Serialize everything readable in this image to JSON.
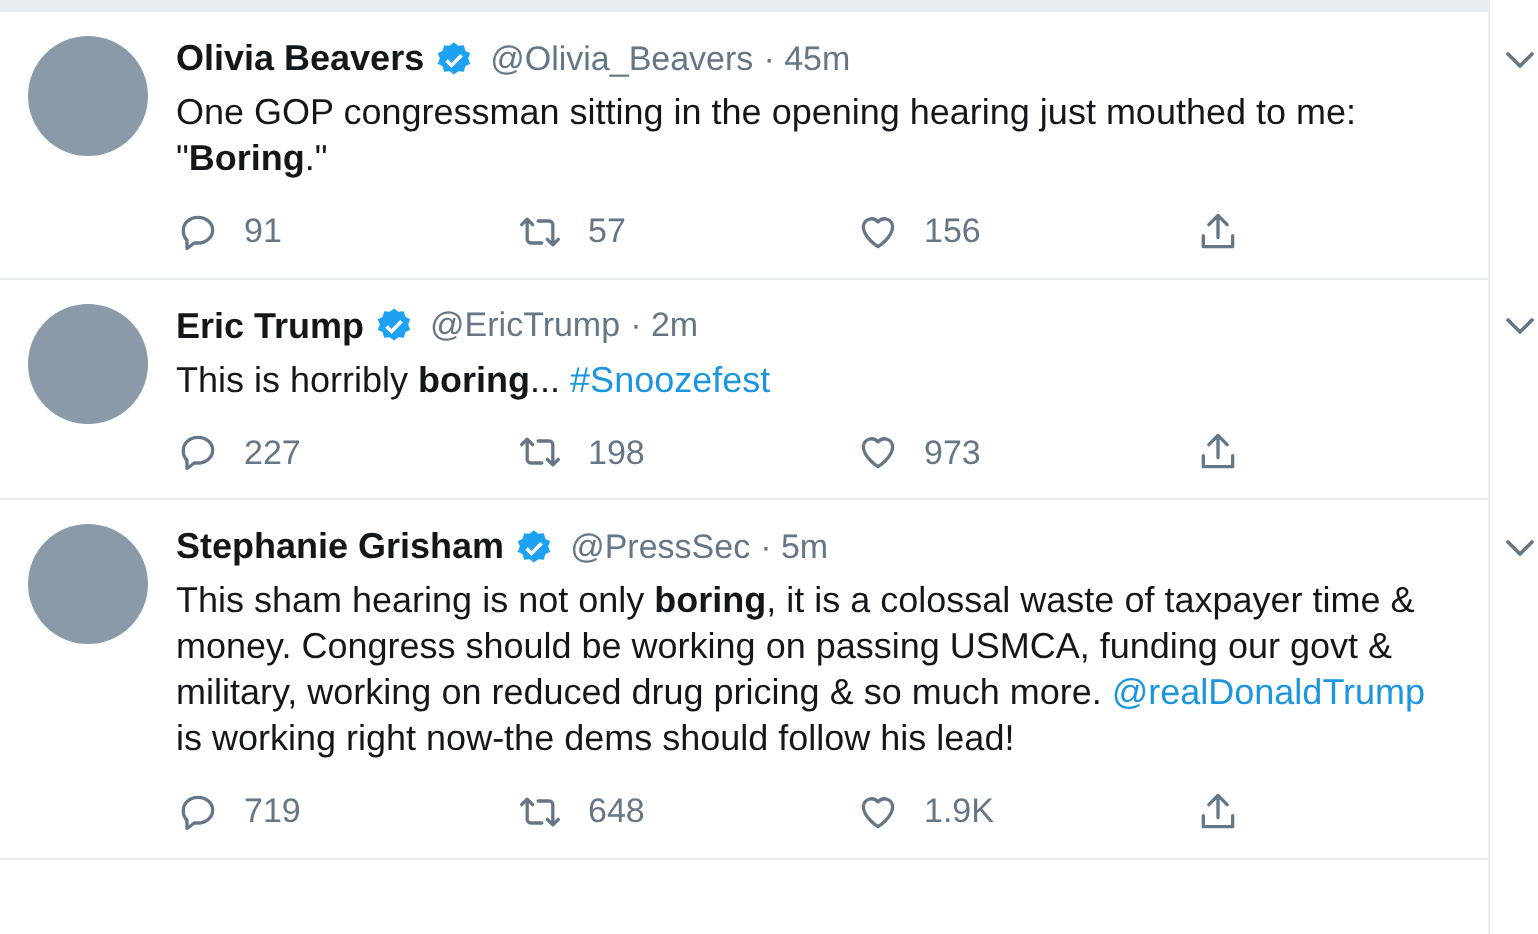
{
  "tweets": [
    {
      "name": "Olivia Beavers",
      "verified": true,
      "handle": "@Olivia_Beavers",
      "time": "· 45m",
      "segments": [
        {
          "kind": "text",
          "text": "One GOP congressman sitting in the opening hearing just mouthed to me: \"**Boring**.\""
        }
      ],
      "replies": "91",
      "retweets": "57",
      "likes": "156"
    },
    {
      "name": "Eric Trump",
      "verified": true,
      "handle": "@EricTrump",
      "time": "· 2m",
      "segments": [
        {
          "kind": "text",
          "text": "This is horribly **boring**... "
        },
        {
          "kind": "link",
          "text": "#Snoozefest"
        }
      ],
      "replies": "227",
      "retweets": "198",
      "likes": "973"
    },
    {
      "name": "Stephanie Grisham",
      "verified": true,
      "handle": "@PressSec",
      "time": "· 5m",
      "segments": [
        {
          "kind": "text",
          "text": "This sham hearing is not only **boring**, it is a colossal waste of taxpayer time & money. Congress should be working on passing USMCA, funding our govt & military, working on reduced drug pricing & so much more. "
        },
        {
          "kind": "link",
          "text": "@realDonaldTrump"
        },
        {
          "kind": "text",
          "text": " is working right now-the dems should follow his lead!"
        }
      ],
      "replies": "719",
      "retweets": "648",
      "likes": "1.9K"
    }
  ]
}
